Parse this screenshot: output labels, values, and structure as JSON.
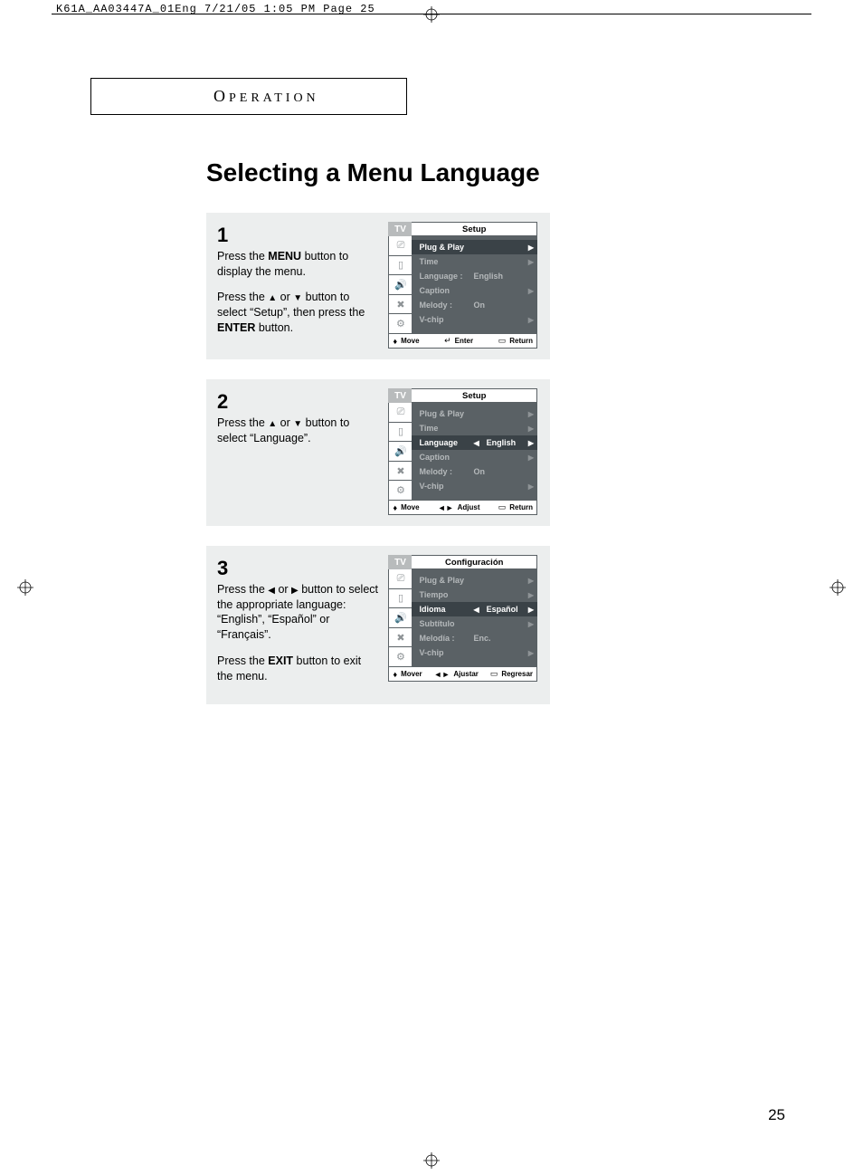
{
  "print_header": "K61A_AA03447A_01Eng  7/21/05  1:05 PM  Page 25",
  "section_heading": "OPERATION",
  "main_title": "Selecting a Menu Language",
  "page_number": "25",
  "steps": [
    {
      "num": "1",
      "paragraphs": [
        "Press the <b>MENU</b> button to display the menu.",
        "Press the <span class='arrow'>▲</span> or <span class='arrow'>▼</span> button to select “Setup”, then press the <b>ENTER</b> button."
      ],
      "osd": {
        "tv": "TV",
        "title": "Setup",
        "rows": [
          {
            "label": "Plug & Play",
            "value": "",
            "arrow_r": true,
            "selected": true
          },
          {
            "label": "Time",
            "value": "",
            "arrow_r": true
          },
          {
            "label": "Language :",
            "value": "English",
            "arrow_r": false
          },
          {
            "label": "Caption",
            "value": "",
            "arrow_r": true
          },
          {
            "label": "Melody    :",
            "value": "On",
            "arrow_r": false
          },
          {
            "label": "V-chip",
            "value": "",
            "arrow_r": true
          }
        ],
        "footer": [
          {
            "icon": "♦",
            "text": "Move"
          },
          {
            "icon": "↵",
            "text": "Enter"
          },
          {
            "icon": "▭",
            "text": "Return"
          }
        ]
      }
    },
    {
      "num": "2",
      "paragraphs": [
        "Press the <span class='arrow'>▲</span> or <span class='arrow'>▼</span> button to select “Language”."
      ],
      "osd": {
        "tv": "TV",
        "title": "Setup",
        "rows": [
          {
            "label": "Plug & Play",
            "value": "",
            "arrow_r": true
          },
          {
            "label": "Time",
            "value": "",
            "arrow_r": true
          },
          {
            "label": "Language",
            "value": "English",
            "arrow_r": true,
            "arrow_l": true,
            "selected": true
          },
          {
            "label": "Caption",
            "value": "",
            "arrow_r": true
          },
          {
            "label": "Melody    :",
            "value": "On",
            "arrow_r": false
          },
          {
            "label": "V-chip",
            "value": "",
            "arrow_r": true
          }
        ],
        "footer": [
          {
            "icon": "♦",
            "text": "Move"
          },
          {
            "icon": "◄►",
            "text": "Adjust"
          },
          {
            "icon": "▭",
            "text": "Return"
          }
        ]
      }
    },
    {
      "num": "3",
      "paragraphs": [
        "Press the <span class='arrow'>◀</span> or <span class='arrow'>▶</span> button to select the appropriate language: “English”, “Español” or “Français”.",
        "Press the <b>EXIT</b> button to exit the menu."
      ],
      "osd": {
        "tv": "TV",
        "title": "Configuración",
        "rows": [
          {
            "label": "Plug & Play",
            "value": "",
            "arrow_r": true
          },
          {
            "label": "Tiempo",
            "value": "",
            "arrow_r": true
          },
          {
            "label": "Idioma",
            "value": "Español",
            "arrow_r": true,
            "arrow_l": true,
            "selected": true
          },
          {
            "label": "Subtítulo",
            "value": "",
            "arrow_r": true
          },
          {
            "label": "Melodía   :",
            "value": "Enc.",
            "arrow_r": false
          },
          {
            "label": "V-chip",
            "value": "",
            "arrow_r": true
          }
        ],
        "footer": [
          {
            "icon": "♦",
            "text": "Mover"
          },
          {
            "icon": "◄►",
            "text": "Ajustar"
          },
          {
            "icon": "▭",
            "text": "Regresar"
          }
        ]
      }
    }
  ],
  "osd_icons": [
    "⎚",
    "▯",
    "🔊",
    "✖",
    "⚙"
  ]
}
